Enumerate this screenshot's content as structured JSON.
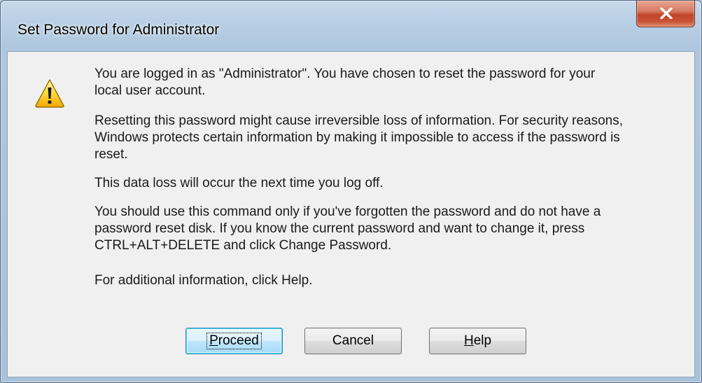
{
  "window": {
    "title": "Set Password for Administrator"
  },
  "icons": {
    "warning": "warning-icon",
    "close": "close-icon"
  },
  "messages": [
    "You are logged in as \"Administrator\". You have chosen to reset the password for your\nlocal user account.",
    "Resetting this password might cause irreversible loss of information. For security reasons,\nWindows protects certain information by making it impossible to access if the password is\nreset.",
    "This data loss will occur the next time you log off.",
    "You should use this command only if you've forgotten the password and do not have a\npassword reset disk. If you know the current password and want to change it, press\nCTRL+ALT+DELETE and click Change Password.",
    "For additional information, click Help."
  ],
  "buttons": {
    "proceed": {
      "access_key": "P",
      "rest": "roceed"
    },
    "cancel": {
      "label": "Cancel"
    },
    "help": {
      "access_key": "H",
      "rest": "elp"
    }
  },
  "colors": {
    "frame": "#b9cfe4",
    "client": "#f0f0f0",
    "close_button": "#c0442a",
    "default_button_border": "#3c7fb1"
  }
}
